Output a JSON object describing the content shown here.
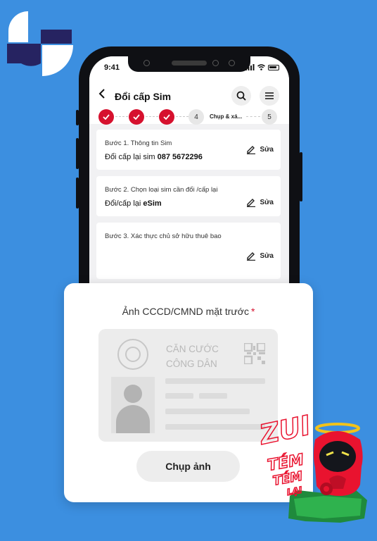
{
  "status_bar": {
    "time": "9:41"
  },
  "app_bar": {
    "title": "Đổi cấp Sim",
    "icons": [
      "back-arrow-icon",
      "search-icon",
      "menu-icon"
    ]
  },
  "stepper": {
    "completed_steps": 3,
    "current_number": "4",
    "current_label": "Chụp & xá...",
    "next_number": "5"
  },
  "cards": [
    {
      "label": "Bước 1. Thông tin Sim",
      "value_prefix": "Đổi cấp lại sim ",
      "value_bold": "087 5672296",
      "edit_label": "Sửa"
    },
    {
      "label": "Bước 2. Chọn loại sim cần đổi /cấp lại",
      "value_prefix": "Đổi/cấp lại ",
      "value_bold": "eSim",
      "edit_label": "Sửa"
    },
    {
      "label": "Bước 3. Xác thực chủ sở hữu thuê bao",
      "edit_label": "Sửa"
    }
  ],
  "popup": {
    "title": "Ảnh CCCD/CMND mặt trước",
    "required_mark": "*",
    "id_card_title_line1": "CĂN CƯỚC",
    "id_card_title_line2": "CÔNG DÂN",
    "button_label": "Chụp ảnh"
  },
  "mascot": {
    "text_line1": "ZUI",
    "text_line2": "TÉM",
    "text_line3": "TÉM",
    "text_line4": "LẠI"
  },
  "colors": {
    "background": "#3c8fe0",
    "accent_red": "#d6112e",
    "logo_dark": "#262361"
  }
}
